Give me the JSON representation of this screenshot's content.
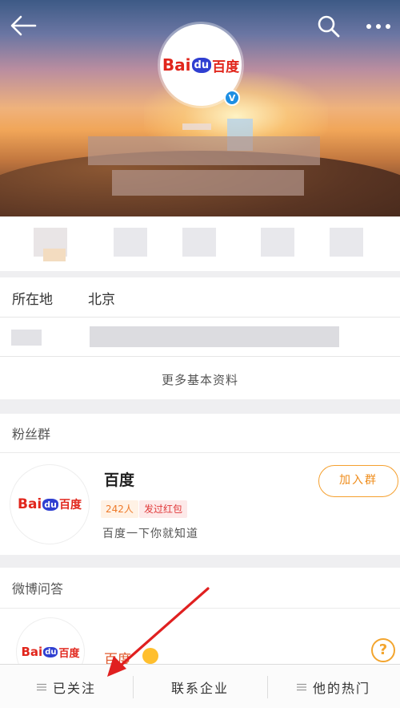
{
  "header": {
    "logo": {
      "latin": "Bai",
      "du": "du",
      "cn": "百度"
    },
    "verified_mark": "V",
    "back_icon": "arrow-left-icon",
    "search_icon": "search-icon",
    "more_icon": "more-dots-icon"
  },
  "info": {
    "location_label": "所在地",
    "location_value": "北京",
    "more_link": "更多基本资料"
  },
  "fans_group": {
    "title": "粉丝群",
    "name": "百度",
    "members_tag": "242人",
    "redpacket_tag": "发过红包",
    "description": "百度一下你就知道",
    "join_label": "加入群"
  },
  "qa": {
    "title": "微博问答",
    "name": "百度"
  },
  "help_icon_glyph": "?",
  "bottom_bar": {
    "tabs": [
      {
        "label": "已关注",
        "has_menu_icon": true
      },
      {
        "label": "联系企业",
        "has_menu_icon": false
      },
      {
        "label": "他的热门",
        "has_menu_icon": true
      }
    ]
  },
  "colors": {
    "accent_orange": "#f5a02f",
    "baidu_red": "#e1261c",
    "baidu_blue": "#2f3fd1",
    "verified_blue": "#1e8fe3",
    "annotation_red": "#e02020"
  }
}
